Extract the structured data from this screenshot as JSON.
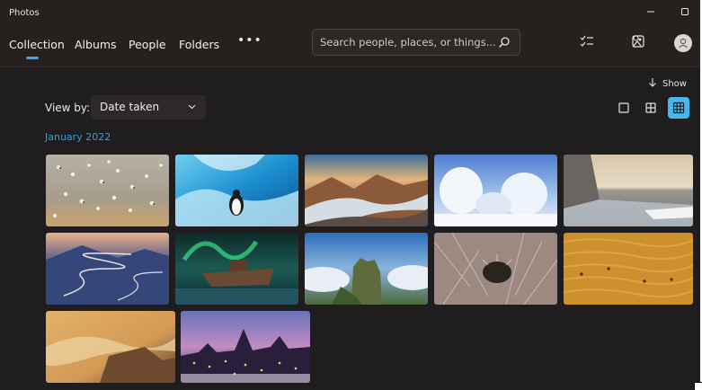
{
  "window": {
    "title": "Photos"
  },
  "nav": {
    "collection": "Collection",
    "albums": "Albums",
    "people": "People",
    "folders": "Folders",
    "more": "•••"
  },
  "search": {
    "placeholder": "Search people, places, or things..."
  },
  "toolbar": {
    "show_label": "Show"
  },
  "view": {
    "label": "View by:",
    "selected": "Date taken"
  },
  "gallery": {
    "month": "January 2022"
  },
  "icons": {
    "minimize": "minimize-icon",
    "maximize": "maximize-icon",
    "search": "search-icon",
    "select": "checklist-icon",
    "import": "import-photo-icon",
    "account": "person-icon",
    "sort": "arrow-down-icon",
    "view_single": "square-icon",
    "view_medium": "grid-4-icon",
    "view_small": "grid-9-icon",
    "dropdown": "chevron-down-icon"
  },
  "colors": {
    "accent": "#3aa7f0",
    "selected_view": "#45b6ee",
    "month": "#3d9bdc",
    "background": "#1f1d1e"
  }
}
